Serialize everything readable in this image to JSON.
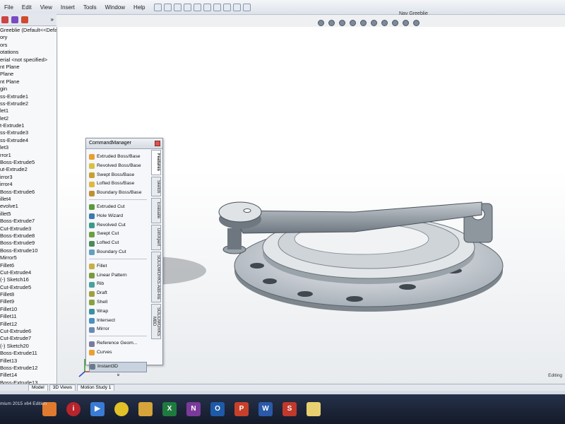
{
  "menu": [
    "File",
    "Edit",
    "View",
    "Insert",
    "Tools",
    "Window",
    "Help"
  ],
  "document_title": "Nav Greeblie",
  "tree": {
    "items": [
      "Greeblie  (Default<<Defa",
      "ory",
      "ors",
      "otations",
      "erial <not specified>",
      "nt Plane",
      "Plane",
      "nt Plane",
      "gin",
      "ss-Extrude1",
      "ss-Extrude2",
      "let1",
      "let2",
      "t-Extrude1",
      "ss-Extrude3",
      "ss-Extrude4",
      "let3",
      "rror1",
      "Boss-Extrude5",
      "ut-Extrude2",
      "irror3",
      "irror4",
      "Boss-Extrude6",
      "illet4",
      "evolve1",
      "illet5",
      "Boss-Extrude7",
      "Cut-Extrude3",
      "Boss-Extrude8",
      "Boss-Extrude9",
      "Boss-Extrude10",
      "Mirror5",
      "Fillet6",
      "Cut-Extrude4",
      "(-) Sketch16",
      "Cut-Extrude5",
      "Fillet8",
      "Fillet9",
      "Fillet10",
      "Fillet11",
      "Fillet12",
      "Cut-Extrude6",
      "Cut-Extrude7",
      "(-) Sketch20",
      "Boss-Extrude11",
      "Fillet13",
      "Boss-Extrude12",
      "Fillet14",
      "Boss-Extrude13"
    ]
  },
  "command_manager": {
    "title": "CommandManager",
    "tabs": [
      "Features",
      "Sketch",
      "Evaluate",
      "DimXpert",
      "SOLIDWORKS Add-Ins",
      "SOLIDWORKS MBD"
    ],
    "groups": [
      [
        "Extruded Boss/Base",
        "Revolved Boss/Base",
        "Swept Boss/Base",
        "Lofted Boss/Base",
        "Boundary Boss/Base"
      ],
      [
        "Extruded Cut",
        "Hole Wizard",
        "Revolved Cut",
        "Swept Cut",
        "Lofted Cut",
        "Boundary Cut"
      ],
      [
        "Fillet",
        "Linear Pattern",
        "Rib",
        "Draft",
        "Shell",
        "Wrap",
        "Intersect",
        "Mirror"
      ],
      [
        "Reference Geom...",
        "Curves"
      ]
    ],
    "instant3d": "Instant3D",
    "more": "»"
  },
  "bottom_tabs": [
    "Model",
    "3D Views",
    "Motion Study 1"
  ],
  "status_left": "mium 2015 x64 Edition",
  "status_right": "Editing",
  "colors": {
    "menubar": "#e6eaf0",
    "canvas": "#ffffff",
    "taskbar": "#1b2333",
    "accent": "#3a6fb0"
  },
  "taskbar_icons": [
    "firefox-icon",
    "info-icon",
    "media-icon",
    "chrome-icon",
    "explorer-icon",
    "excel-icon",
    "onenote-icon",
    "outlook-icon",
    "powerpoint-icon",
    "word-icon",
    "solidworks-icon",
    "file-icon"
  ]
}
